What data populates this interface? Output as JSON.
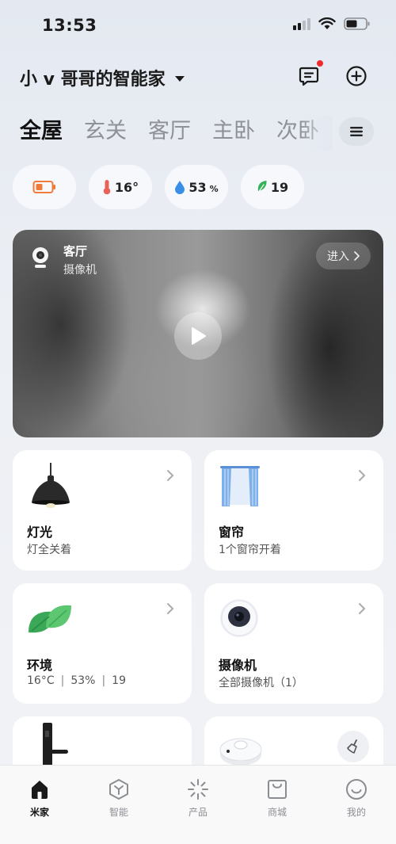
{
  "status_bar": {
    "time": "13:53"
  },
  "header": {
    "home_name": "小 v 哥哥的智能家"
  },
  "tabs": [
    "全屋",
    "玄关",
    "客厅",
    "主卧",
    "次卧"
  ],
  "environment": {
    "temperature": "16°",
    "humidity_value": "53",
    "humidity_unit": "%",
    "air_quality": "19"
  },
  "camera_card": {
    "room": "客厅",
    "device_type": "摄像机",
    "enter_label": "进入"
  },
  "cards": {
    "lights": {
      "title": "灯光",
      "subtitle": "灯全关着"
    },
    "curtains": {
      "title": "窗帘",
      "subtitle": "1个窗帘开着"
    },
    "environment": {
      "title": "环境",
      "temp": "16°C",
      "humidity": "53%",
      "aqi": "19"
    },
    "cameras": {
      "title": "摄像机",
      "subtitle": "全部摄像机（1）"
    }
  },
  "bottom_nav": [
    {
      "label": "米家",
      "icon": "home-icon",
      "active": true
    },
    {
      "label": "智能",
      "icon": "smart-icon",
      "active": false
    },
    {
      "label": "产品",
      "icon": "product-icon",
      "active": false
    },
    {
      "label": "商城",
      "icon": "shop-icon",
      "active": false
    },
    {
      "label": "我的",
      "icon": "profile-icon",
      "active": false
    }
  ],
  "colors": {
    "accent_red": "#ef2a2a",
    "battery_orange": "#f07a3a",
    "thermo_red": "#e8625a",
    "drop_blue": "#3a8ee8",
    "leaf_green": "#34b25a"
  }
}
